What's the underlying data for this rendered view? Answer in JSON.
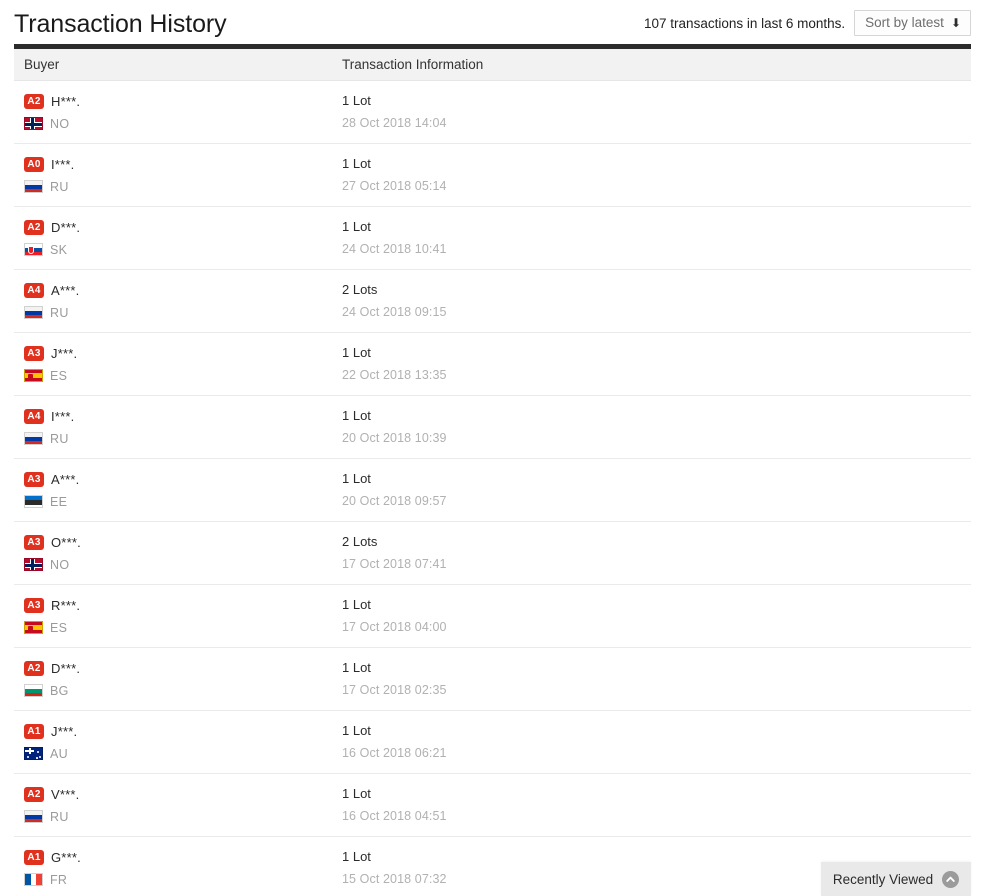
{
  "header": {
    "title": "Transaction History",
    "transaction_count_text": "107 transactions in last 6 months.",
    "sort_button_label": "Sort by latest",
    "sort_button_icon": "arrow-down-icon"
  },
  "table": {
    "columns": {
      "buyer": "Buyer",
      "transaction_information": "Transaction Information"
    },
    "rows": [
      {
        "rating": "A2",
        "buyer": "H***.",
        "country": "NO",
        "lots": "1 Lot",
        "date": "28 Oct 2018 14:04"
      },
      {
        "rating": "A0",
        "buyer": "I***.",
        "country": "RU",
        "lots": "1 Lot",
        "date": "27 Oct 2018 05:14"
      },
      {
        "rating": "A2",
        "buyer": "D***.",
        "country": "SK",
        "lots": "1 Lot",
        "date": "24 Oct 2018 10:41"
      },
      {
        "rating": "A4",
        "buyer": "A***.",
        "country": "RU",
        "lots": "2 Lots",
        "date": "24 Oct 2018 09:15"
      },
      {
        "rating": "A3",
        "buyer": "J***.",
        "country": "ES",
        "lots": "1 Lot",
        "date": "22 Oct 2018 13:35"
      },
      {
        "rating": "A4",
        "buyer": "I***.",
        "country": "RU",
        "lots": "1 Lot",
        "date": "20 Oct 2018 10:39"
      },
      {
        "rating": "A3",
        "buyer": "A***.",
        "country": "EE",
        "lots": "1 Lot",
        "date": "20 Oct 2018 09:57"
      },
      {
        "rating": "A3",
        "buyer": "O***.",
        "country": "NO",
        "lots": "2 Lots",
        "date": "17 Oct 2018 07:41"
      },
      {
        "rating": "A3",
        "buyer": "R***.",
        "country": "ES",
        "lots": "1 Lot",
        "date": "17 Oct 2018 04:00"
      },
      {
        "rating": "A2",
        "buyer": "D***.",
        "country": "BG",
        "lots": "1 Lot",
        "date": "17 Oct 2018 02:35"
      },
      {
        "rating": "A1",
        "buyer": "J***.",
        "country": "AU",
        "lots": "1 Lot",
        "date": "16 Oct 2018 06:21"
      },
      {
        "rating": "A2",
        "buyer": "V***.",
        "country": "RU",
        "lots": "1 Lot",
        "date": "16 Oct 2018 04:51"
      },
      {
        "rating": "A1",
        "buyer": "G***.",
        "country": "FR",
        "lots": "1 Lot",
        "date": "15 Oct 2018 07:32"
      }
    ]
  },
  "recently_viewed": {
    "label": "Recently Viewed",
    "icon": "chevron-up-circle-icon"
  },
  "colors": {
    "badge_red": "#e0301e",
    "rule_dark": "#2b2b2b",
    "header_row_bg": "#f2f2f2",
    "muted_text": "#b1b1b1",
    "widget_bg": "#e9e9e9"
  }
}
